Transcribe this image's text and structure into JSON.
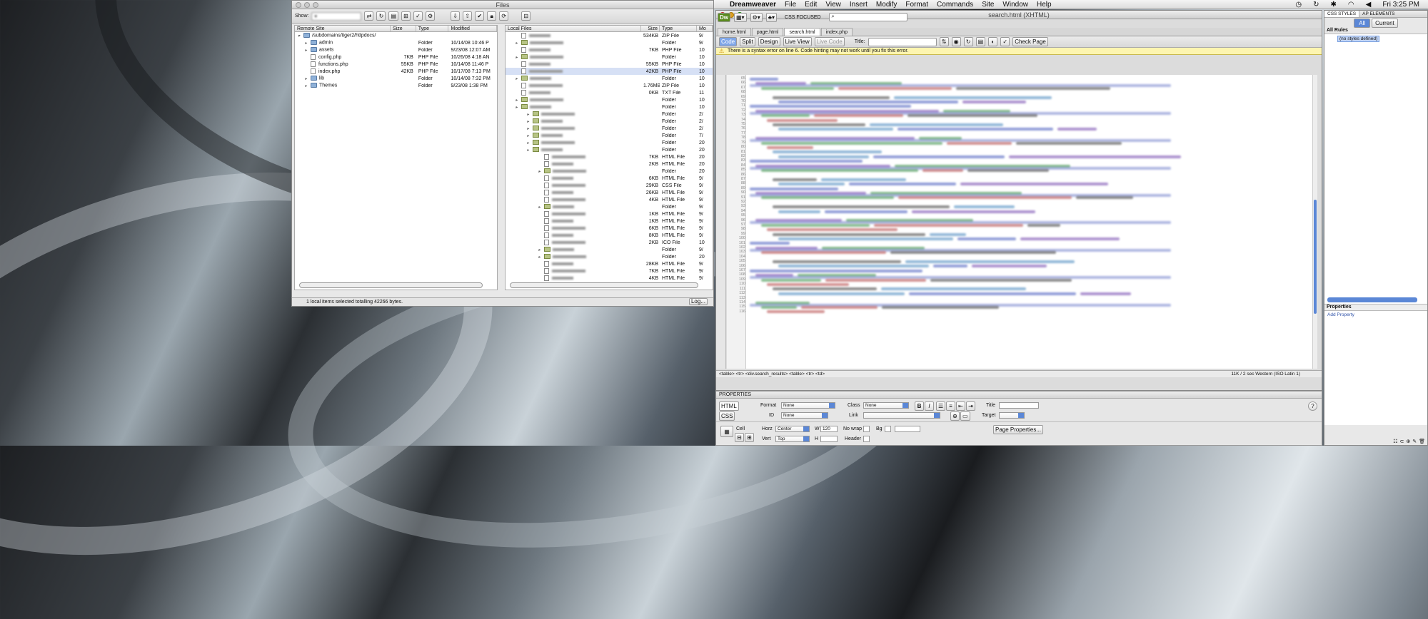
{
  "menubar": {
    "app": "Dreamweaver",
    "items": [
      "File",
      "Edit",
      "View",
      "Insert",
      "Modify",
      "Format",
      "Commands",
      "Site",
      "Window",
      "Help"
    ],
    "clock": "Fri 3:25 PM"
  },
  "files_window": {
    "title": "Files",
    "show_label": "Show:",
    "remote": {
      "columns": [
        "Remote Site",
        "Size",
        "Type",
        "Modified"
      ],
      "root": "/subdomains/tiger2/httpdocs/",
      "rows": [
        {
          "name": "admin",
          "size": "",
          "type": "Folder",
          "modified": "10/14/08 10:46 P",
          "kind": "folder"
        },
        {
          "name": "assets",
          "size": "",
          "type": "Folder",
          "modified": "9/23/08 12:07 AM",
          "kind": "folder"
        },
        {
          "name": "config.php",
          "size": "7KB",
          "type": "PHP File",
          "modified": "10/26/08 4:18 AN",
          "kind": "file"
        },
        {
          "name": "functions.php",
          "size": "55KB",
          "type": "PHP File",
          "modified": "10/14/08 11:46 P",
          "kind": "file"
        },
        {
          "name": "index.php",
          "size": "42KB",
          "type": "PHP File",
          "modified": "10/17/08 7:13 PM",
          "kind": "file"
        },
        {
          "name": "lib",
          "size": "",
          "type": "Folder",
          "modified": "10/14/08 7:32 PM",
          "kind": "folder"
        },
        {
          "name": "Themes",
          "size": "",
          "type": "Folder",
          "modified": "9/23/08 1:38 PM",
          "kind": "folder"
        }
      ]
    },
    "local": {
      "columns": [
        "Local Files",
        "Size",
        "Type",
        "Mo"
      ],
      "rows": [
        {
          "size": "534KB",
          "type": "ZIP File",
          "mod": "9/"
        },
        {
          "size": "",
          "type": "Folder",
          "mod": "9/"
        },
        {
          "size": "7KB",
          "type": "PHP File",
          "mod": "10"
        },
        {
          "size": "",
          "type": "Folder",
          "mod": "10"
        },
        {
          "size": "55KB",
          "type": "PHP File",
          "mod": "10"
        },
        {
          "size": "42KB",
          "type": "PHP File",
          "mod": "10"
        },
        {
          "size": "",
          "type": "Folder",
          "mod": "10"
        },
        {
          "size": "1.76MB",
          "type": "ZIP File",
          "mod": "10"
        },
        {
          "size": "0KB",
          "type": "TXT File",
          "mod": "11"
        },
        {
          "size": "",
          "type": "Folder",
          "mod": "10"
        },
        {
          "size": "",
          "type": "Folder",
          "mod": "10"
        },
        {
          "size": "",
          "type": "Folder",
          "mod": "2/"
        },
        {
          "size": "",
          "type": "Folder",
          "mod": "2/"
        },
        {
          "size": "",
          "type": "Folder",
          "mod": "2/"
        },
        {
          "size": "",
          "type": "Folder",
          "mod": "7/"
        },
        {
          "size": "",
          "type": "Folder",
          "mod": "20"
        },
        {
          "size": "",
          "type": "Folder",
          "mod": "20"
        },
        {
          "size": "7KB",
          "type": "HTML File",
          "mod": "20"
        },
        {
          "size": "2KB",
          "type": "HTML File",
          "mod": "20"
        },
        {
          "size": "",
          "type": "Folder",
          "mod": "20"
        },
        {
          "size": "6KB",
          "type": "HTML File",
          "mod": "9/"
        },
        {
          "size": "29KB",
          "type": "CSS File",
          "mod": "9/"
        },
        {
          "size": "26KB",
          "type": "HTML File",
          "mod": "9/"
        },
        {
          "size": "4KB",
          "type": "HTML File",
          "mod": "9/"
        },
        {
          "size": "",
          "type": "Folder",
          "mod": "9/"
        },
        {
          "size": "1KB",
          "type": "HTML File",
          "mod": "9/"
        },
        {
          "size": "1KB",
          "type": "HTML File",
          "mod": "9/"
        },
        {
          "size": "6KB",
          "type": "HTML File",
          "mod": "9/"
        },
        {
          "size": "8KB",
          "type": "HTML File",
          "mod": "9/"
        },
        {
          "size": "2KB",
          "type": "ICO File",
          "mod": "10"
        },
        {
          "size": "",
          "type": "Folder",
          "mod": "9/"
        },
        {
          "size": "",
          "type": "Folder",
          "mod": "20"
        },
        {
          "size": "28KB",
          "type": "HTML File",
          "mod": "9/"
        },
        {
          "size": "7KB",
          "type": "HTML File",
          "mod": "9/"
        },
        {
          "size": "4KB",
          "type": "HTML File",
          "mod": "9/"
        }
      ]
    },
    "status": "1 local items selected totalling 42266 bytes.",
    "log_button": "Log..."
  },
  "dw_window": {
    "title": "search.html (XHTML)",
    "tabs": [
      "home.html",
      "page.html",
      "search.html",
      "index.php"
    ],
    "active_tab": 2,
    "view_buttons": {
      "code": "Code",
      "split": "Split",
      "design": "Design",
      "live_view": "Live View",
      "live_code": "Live Code"
    },
    "title_label": "Title:",
    "check_page": "Check Page",
    "css_focused": "CSS FOCUSED",
    "warning": "There is a syntax error on line 6. Code hinting may not work until you fix this error.",
    "line_start": 65,
    "line_end": 116,
    "tag_path": "<table> <tr> <div.search_results> <table> <tr> <td>",
    "status_right": "11K / 2 sec   Western (ISO Latin 1)"
  },
  "properties": {
    "header": "PROPERTIES",
    "html_btn": "HTML",
    "css_btn": "CSS",
    "format_label": "Format",
    "format_value": "None",
    "class_label": "Class",
    "class_value": "None",
    "id_label": "ID",
    "id_value": "None",
    "link_label": "Link",
    "title_label": "Title",
    "target_label": "Target",
    "cell_label": "Cell",
    "horz_label": "Horz",
    "horz_value": "Center",
    "vert_label": "Vert",
    "vert_value": "Top",
    "w_label": "W",
    "w_value": "120",
    "h_label": "H",
    "nowrap_label": "No wrap",
    "header_label": "Header",
    "bg_label": "Bg",
    "page_props": "Page Properties..."
  },
  "css_panel": {
    "tab_styles": "CSS STYLES",
    "tab_ap": "AP ELEMENTS",
    "btn_all": "All",
    "btn_current": "Current",
    "all_rules": "All Rules",
    "no_styles": "(no styles defined)",
    "properties": "Properties",
    "add_property": "Add Property"
  }
}
